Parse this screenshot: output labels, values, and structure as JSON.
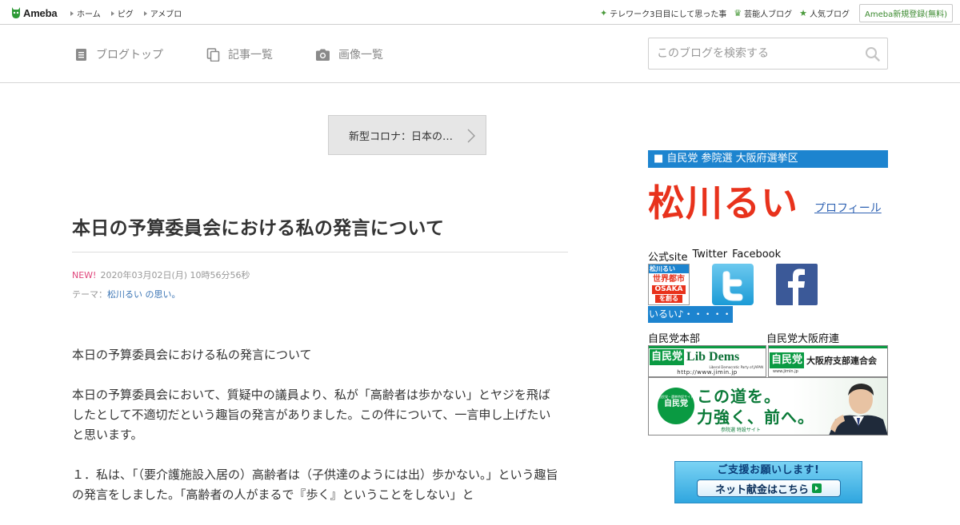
{
  "topbar": {
    "logo_text": "Ameba",
    "nav": [
      {
        "label": "ホーム"
      },
      {
        "label": "ピグ"
      },
      {
        "label": "アメブロ"
      }
    ],
    "right": [
      {
        "icon": "sparkle-icon",
        "label": "テレワーク3日目にして思った事"
      },
      {
        "icon": "crown-icon",
        "label": "芸能人ブログ"
      },
      {
        "icon": "star-icon",
        "label": "人気ブログ"
      }
    ],
    "register_label": "Ameba新規登録(無料)"
  },
  "blognav": {
    "items": [
      {
        "icon": "document-icon",
        "label": "ブログトップ"
      },
      {
        "icon": "copy-icon",
        "label": "記事一覧"
      },
      {
        "icon": "camera-icon",
        "label": "画像一覧"
      }
    ],
    "search_placeholder": "このブログを検索する"
  },
  "article": {
    "theme_nav_label": "新型コロナ：日本の…",
    "title": "本日の予算委員会における私の発言について",
    "new_label": "NEW!",
    "date": "2020年03月02日(月) 10時56分56秒",
    "theme_prefix": "テーマ：",
    "theme_link": "松川るい の思い。",
    "paragraphs": [
      "本日の予算委員会における私の発言について",
      "本日の予算委員会において、質疑中の議員より、私が「高齢者は歩かない」とヤジを飛ばしたとして不適切だという趣旨の発言がありました。この件について、一言申し上げたいと思います。",
      "１．私は、「（要介護施設入居の）高齢者は（子供達のようには出）歩かない。」という趣旨の発言をしました。「高齢者の人がまるで『歩く』ということをしない」と"
    ]
  },
  "sidebar": {
    "header": "■ 自民党 参院選 大阪府選挙区",
    "name": "松川るい",
    "profile_link": "プロフィール",
    "social_labels": [
      "公式site",
      "Twitter",
      "Facebook"
    ],
    "site_badge": {
      "line1": "松川るい",
      "line2": "世界都市",
      "line3": "OSAKA",
      "line4": "を創る"
    },
    "ticker": "いるい♪・・・・・",
    "hq_label": "自民党本部",
    "osaka_label": "自民党大阪府連",
    "hq_banner": {
      "jp": "自民党",
      "en": "Lib Dems",
      "sub": "Liberal Democratic Party of JAPAN",
      "url": "http://www.jimin.jp"
    },
    "osaka_banner": {
      "jp": "自民党",
      "text": "大阪府支部連合会",
      "url": "www.jimin.jp"
    },
    "abe_banner": {
      "badge": "自民党",
      "badge_top": "自民党・選挙特設サイト",
      "line1": "この道を。",
      "line2": "力強く、前へ。",
      "sub": "参院選 特設サイト"
    },
    "donate_banner": {
      "line1": "ご支援お願いします!",
      "button": "ネット献金はこちら"
    }
  }
}
